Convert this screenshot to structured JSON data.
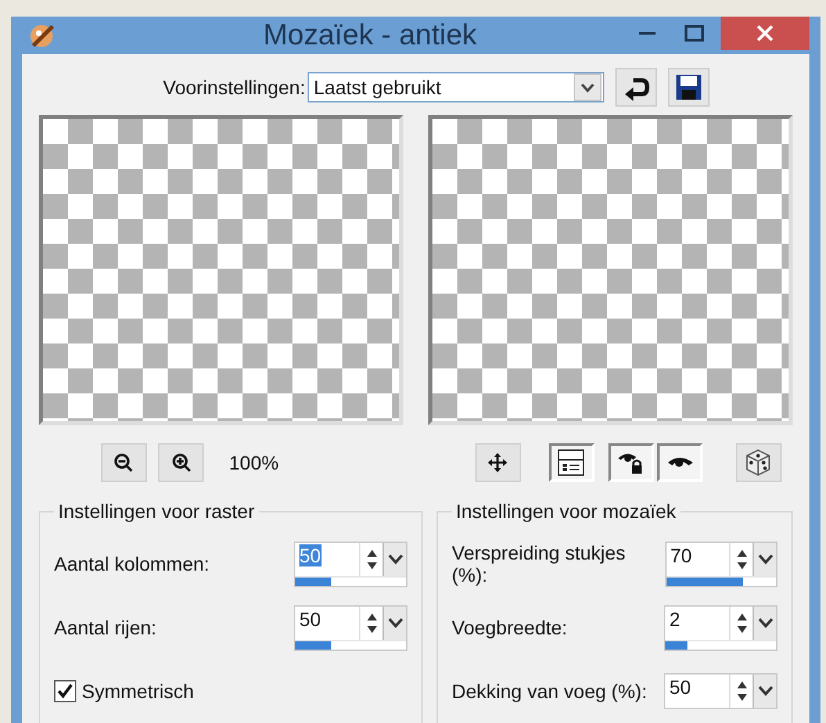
{
  "window": {
    "title": "Mozaïek - antiek"
  },
  "presets": {
    "label": "Voorinstellingen:",
    "value": "Laatst gebruikt"
  },
  "toolbar": {
    "zoom_text": "100%",
    "toggles": [
      {
        "kind": "layout",
        "pressed": true
      },
      {
        "kind": "lock-eye",
        "pressed": true
      },
      {
        "kind": "eye",
        "pressed": true
      }
    ]
  },
  "groups": [
    {
      "title": "Instellingen voor raster",
      "fields": [
        {
          "kind": "spin",
          "label": "Aantal kolommen:",
          "value": "50",
          "level": 0.33,
          "text_selected": true
        },
        {
          "kind": "spin",
          "label": "Aantal rijen:",
          "value": "50",
          "level": 0.33,
          "text_selected": false
        },
        {
          "kind": "checkbox",
          "label": "Symmetrisch",
          "checked": true
        }
      ]
    },
    {
      "title": "Instellingen voor mozaïek",
      "fields": [
        {
          "kind": "spin",
          "label": "Verspreiding stukjes (%):",
          "value": "70",
          "level": 0.7,
          "text_selected": false
        },
        {
          "kind": "spin",
          "label": "Voegbreedte:",
          "value": "2",
          "level": 0.2,
          "text_selected": false
        },
        {
          "kind": "spin",
          "label": "Dekking van voeg (%):",
          "value": "50",
          "text_selected": false
        }
      ]
    }
  ]
}
